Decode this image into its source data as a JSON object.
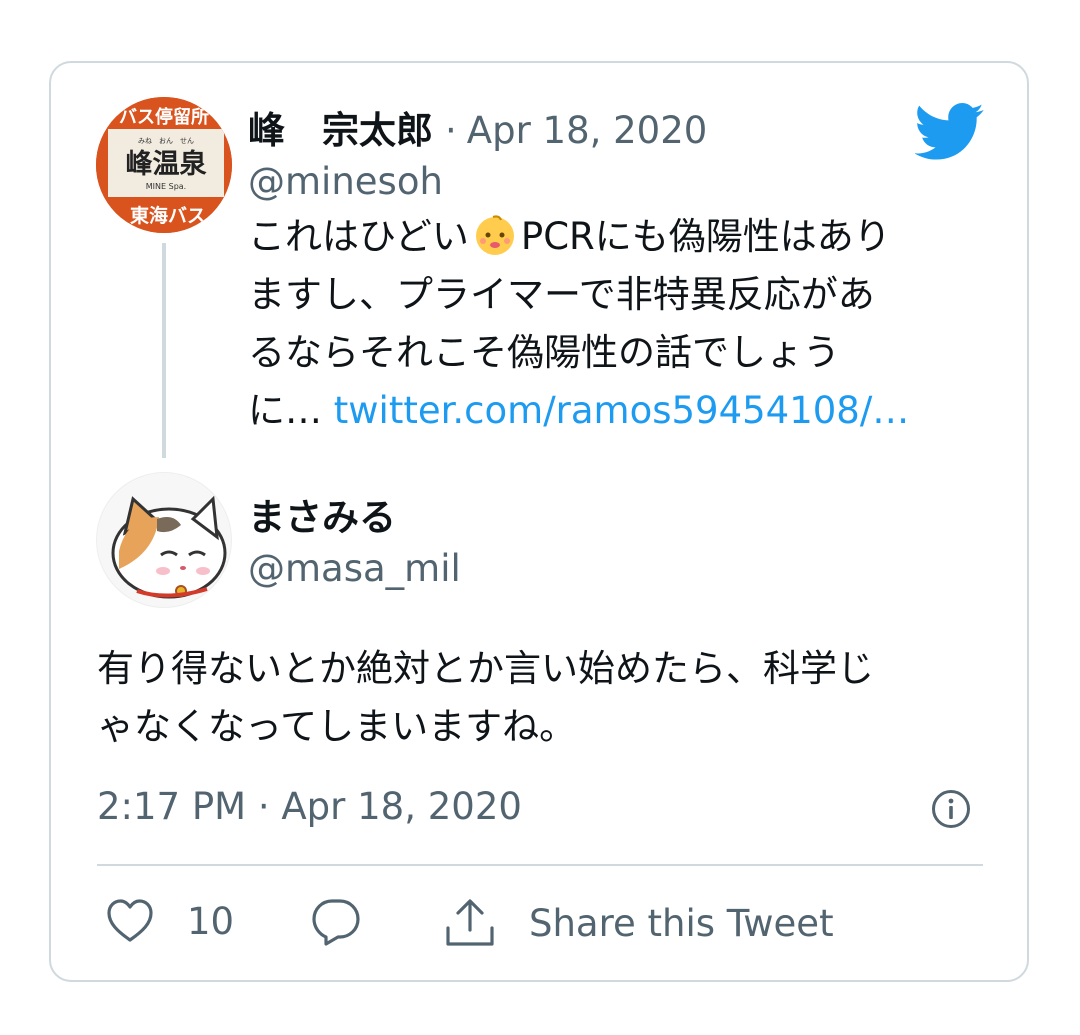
{
  "quoted_tweet": {
    "author_name": "峰　宗太郎",
    "separator": "·",
    "date": "Apr 18, 2020",
    "handle": "@minesoh",
    "avatar_sign": {
      "top": "バス停留所",
      "furigana": "みね　おん　せん",
      "main": "峰温泉",
      "sub": "MINE Spa.",
      "bottom": "東海バス"
    },
    "text_lines": [
      "これはひどい",
      "PCRにも偽陽性はあり",
      "ますし、プライマーで非特異反応があ",
      "るならそれこそ偽陽性の話でしょう",
      "に… "
    ],
    "link_text": "twitter.com/ramos59454108/…",
    "emoji": "baby-face-emoji"
  },
  "reply": {
    "author_name": "まさみる",
    "handle": "@masa_mil",
    "text_lines": [
      "有り得ないとか絶対とか言い始めたら、科学じ",
      "ゃなくなってしまいますね。"
    ],
    "timestamp": "2:17 PM · Apr 18, 2020"
  },
  "actions": {
    "like_count": "10",
    "share_label": "Share this Tweet"
  },
  "colors": {
    "twitter_blue": "#1d9bf0",
    "secondary_text": "#536471",
    "border": "#cfd9de",
    "like_heart": "#536471"
  },
  "icons": [
    "twitter-bird-icon",
    "info-icon",
    "heart-icon",
    "reply-icon",
    "share-icon"
  ]
}
